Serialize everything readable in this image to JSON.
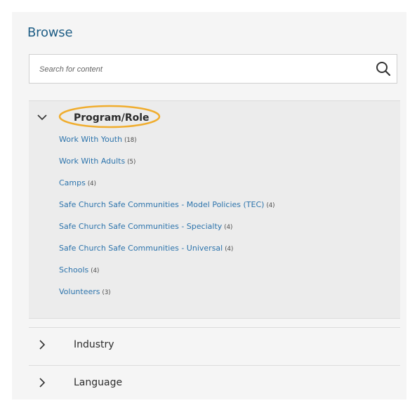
{
  "browse": {
    "title": "Browse"
  },
  "search": {
    "placeholder": "Search for content",
    "value": ""
  },
  "facets": [
    {
      "title": "Program/Role",
      "expanded": true,
      "highlight_color": "#f0ad2e",
      "items": [
        {
          "label": "Work With Youth",
          "count": "(18)"
        },
        {
          "label": "Work With Adults",
          "count": "(5)"
        },
        {
          "label": "Camps",
          "count": "(4)"
        },
        {
          "label": "Safe Church Safe Communities - Model Policies (TEC)",
          "count": "(4)"
        },
        {
          "label": "Safe Church Safe Communities - Specialty",
          "count": "(4)"
        },
        {
          "label": "Safe Church Safe Communities - Universal",
          "count": "(4)"
        },
        {
          "label": "Schools",
          "count": "(4)"
        },
        {
          "label": "Volunteers",
          "count": "(3)"
        }
      ]
    },
    {
      "title": "Industry",
      "expanded": false
    },
    {
      "title": "Language",
      "expanded": false
    }
  ],
  "colors": {
    "link": "#2d74ac",
    "title": "#1f5e86",
    "panel_bg": "#f5f5f5",
    "open_facet_bg": "#ececec"
  }
}
